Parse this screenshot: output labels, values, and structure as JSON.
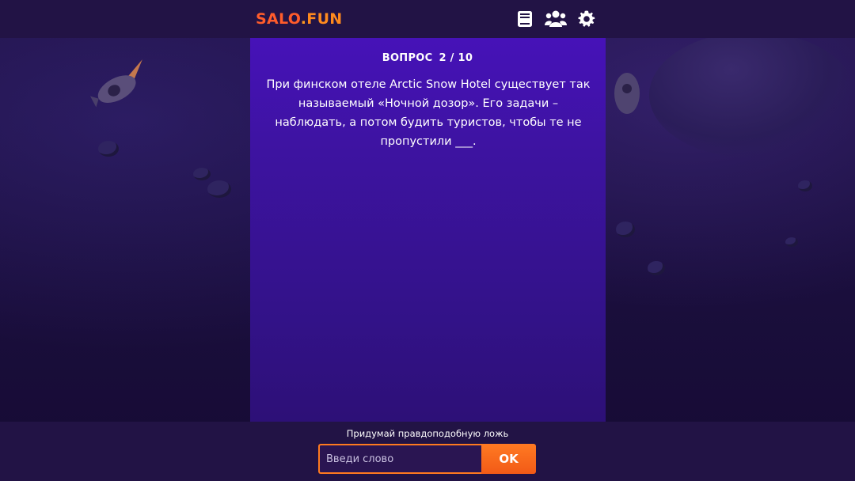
{
  "header": {
    "logo_part1": "SALO",
    "logo_dot": ".",
    "logo_part2": "FUN",
    "icons": [
      "book-icon",
      "users-icon",
      "gear-icon"
    ]
  },
  "question": {
    "label": "ВОПРОС",
    "counter": "2 / 10",
    "current": 2,
    "total": 10,
    "text": "При финском отеле Arctic Snow Hotel существует так называемый «Ночной дозор». Его задачи – наблюдать, а потом будить туристов, чтобы те не пропустили ___."
  },
  "answer": {
    "hint": "Придумай правдоподобную ложь",
    "placeholder": "Введи слово",
    "value": "",
    "submit_label": "OK"
  },
  "colors": {
    "accent": "#ff7a1f",
    "logo_orange": "#ff5c2b",
    "card_purple": "#4612b8",
    "background": "#1b0f3e"
  }
}
